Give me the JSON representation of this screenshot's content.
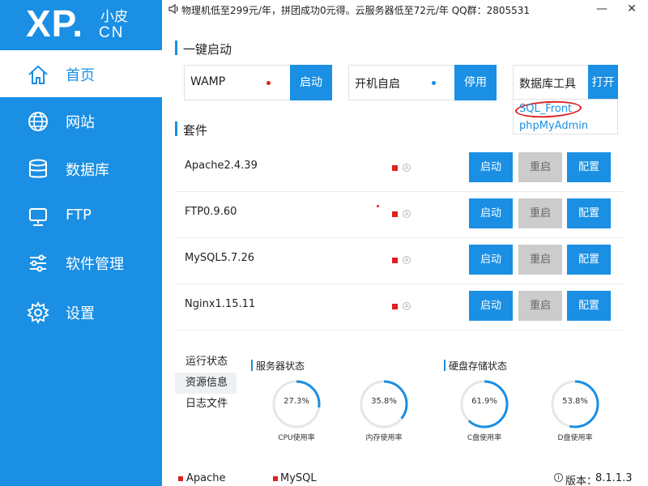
{
  "logo": {
    "main": "XP.",
    "top": "小皮",
    "bottom": "CN"
  },
  "sidebar": {
    "items": [
      {
        "label": "首页",
        "icon": "home-icon",
        "active": true
      },
      {
        "label": "网站",
        "icon": "globe-icon",
        "active": false
      },
      {
        "label": "数据库",
        "icon": "database-icon",
        "active": false
      },
      {
        "label": "FTP",
        "icon": "ftp-icon",
        "active": false
      },
      {
        "label": "软件管理",
        "icon": "sliders-icon",
        "active": false
      },
      {
        "label": "设置",
        "icon": "gear-icon",
        "active": false
      }
    ]
  },
  "topbar": {
    "notice": "物理机低至299元/年，拼团成功0元得。云服务器低至72元/年 QQ群：2805531",
    "minimize": "—",
    "close": "✕"
  },
  "quick_start": {
    "title": "一键启动",
    "groups": [
      {
        "label": "WAMP",
        "button": "启动",
        "dot_color": "#e02020"
      },
      {
        "label": "开机自启",
        "button": "停用",
        "dot_color": "#1a8fe3"
      },
      {
        "label": "数据库工具",
        "button": "打开"
      }
    ],
    "dropdown": [
      "SQL_Front",
      "phpMyAdmin"
    ]
  },
  "suite": {
    "title": "套件",
    "rows": [
      {
        "name": "Apache2.4.39",
        "start": "启动",
        "restart": "重启",
        "config": "配置"
      },
      {
        "name": "FTP0.9.60",
        "start": "启动",
        "restart": "重启",
        "config": "配置"
      },
      {
        "name": "MySQL5.7.26",
        "start": "启动",
        "restart": "重启",
        "config": "配置"
      },
      {
        "name": "Nginx1.15.11",
        "start": "启动",
        "restart": "重启",
        "config": "配置"
      }
    ]
  },
  "info": {
    "tabs": [
      "运行状态",
      "资源信息",
      "日志文件"
    ],
    "selected_tab": 1,
    "server_title": "服务器状态",
    "disk_title": "硬盘存储状态",
    "gauges": [
      {
        "value": "27.3%",
        "label": "CPU使用率",
        "percent": 27.3
      },
      {
        "value": "35.8%",
        "label": "内存使用率",
        "percent": 35.8
      },
      {
        "value": "61.9%",
        "label": "C盘使用率",
        "percent": 61.9
      },
      {
        "value": "53.8%",
        "label": "D盘使用率",
        "percent": 53.8
      }
    ]
  },
  "footer": {
    "items": [
      "Apache",
      "MySQL"
    ],
    "version_label": "版本：",
    "version": "8.1.1.3"
  },
  "colors": {
    "accent": "#1a8fe3",
    "stopped": "#e02020",
    "disabled": "#cccccc"
  }
}
